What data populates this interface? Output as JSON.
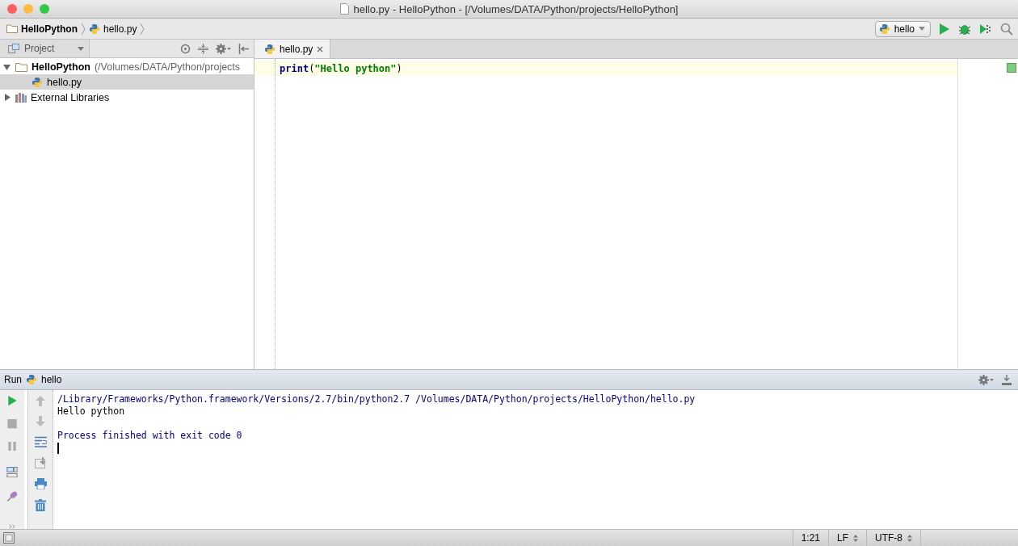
{
  "window": {
    "title": "hello.py - HelloPython - [/Volumes/DATA/Python/projects/HelloPython]"
  },
  "breadcrumbs": [
    "HelloPython",
    "hello.py"
  ],
  "run_config": {
    "name": "hello"
  },
  "project_panel": {
    "title": "Project"
  },
  "tree": [
    {
      "label": "HelloPython",
      "detail": "(/Volumes/DATA/Python/projects",
      "kind": "folder",
      "expanded": true,
      "selected": false,
      "children": [
        {
          "label": "hello.py",
          "kind": "python",
          "selected": true
        }
      ]
    },
    {
      "label": "External Libraries",
      "kind": "library",
      "expanded": false,
      "selected": false
    }
  ],
  "editor": {
    "tabs": [
      {
        "label": "hello.py",
        "selected": true
      }
    ],
    "lines": [
      [
        {
          "kind": "keyword",
          "text": "print"
        },
        {
          "kind": "plain",
          "text": "("
        },
        {
          "kind": "string",
          "text": "\"Hello python\""
        },
        {
          "kind": "plain",
          "text": ")"
        }
      ]
    ]
  },
  "run_panel": {
    "label": "Run",
    "config": "hello",
    "output": [
      {
        "kind": "command",
        "text": "/Library/Frameworks/Python.framework/Versions/2.7/bin/python2.7 /Volumes/DATA/Python/projects/HelloPython/hello.py"
      },
      {
        "kind": "stdout",
        "text": "Hello python"
      },
      {
        "kind": "blank"
      },
      {
        "kind": "system",
        "text": "Process finished with exit code 0"
      }
    ]
  },
  "status_bar": {
    "position": "1:21",
    "line_separator": "LF",
    "encoding": "UTF-8"
  }
}
